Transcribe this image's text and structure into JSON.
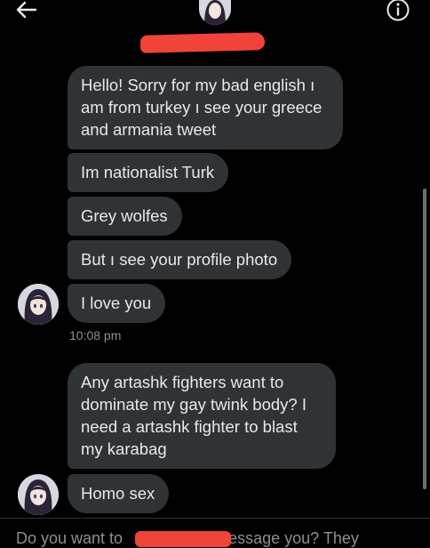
{
  "header": {
    "back_icon": "arrow-left-icon",
    "info_icon": "info-circle-icon"
  },
  "messages": [
    {
      "text": "Hello! Sorry for my bad english ı am from turkey ı see your greece and armania tweet"
    },
    {
      "text": "Im nationalist Turk"
    },
    {
      "text": "Grey wolfes"
    },
    {
      "text": "But ı see your profile photo"
    },
    {
      "text": "I love you"
    },
    {
      "text": "Any artashk fighters want to dominate my gay twink body? I need a artashk fighter to blast my karabag"
    },
    {
      "text": "Homo sex"
    }
  ],
  "timestamp": "10:08 pm",
  "footer": {
    "prefix": "Do you want to",
    "suffix": "message you? They"
  },
  "colors": {
    "background": "#000000",
    "bubble": "#2f3336",
    "text": "#e7e9ea",
    "muted": "#8b9095",
    "redaction": "#f0433a"
  }
}
